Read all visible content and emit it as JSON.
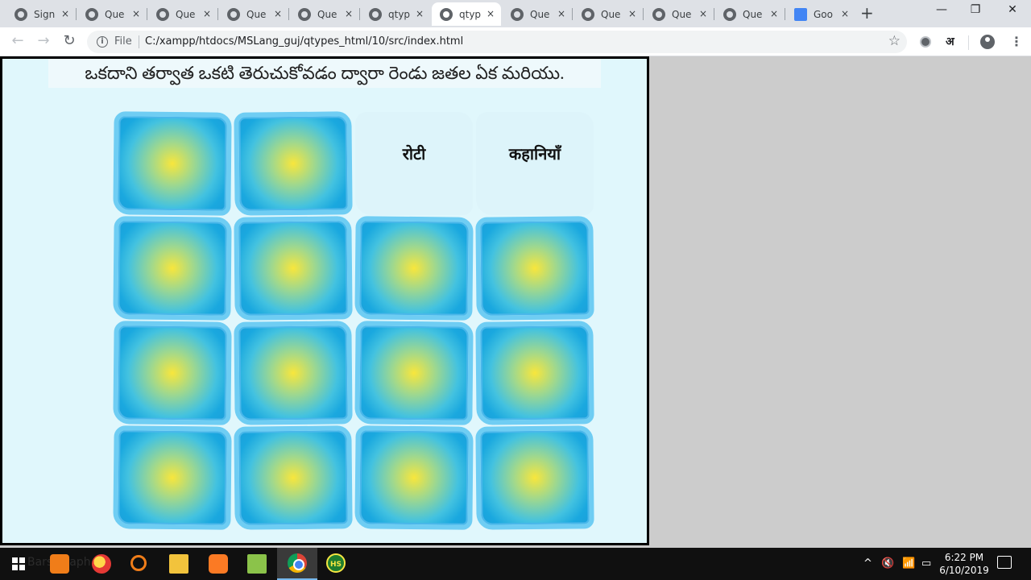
{
  "browser": {
    "tabs": [
      {
        "title": "Sign",
        "icon": "globe-icon",
        "active": false
      },
      {
        "title": "Que",
        "icon": "globe-icon",
        "active": false
      },
      {
        "title": "Que",
        "icon": "globe-icon",
        "active": false
      },
      {
        "title": "Que",
        "icon": "globe-icon",
        "active": false
      },
      {
        "title": "Que",
        "icon": "globe-icon",
        "active": false
      },
      {
        "title": "qtyp",
        "icon": "globe-icon",
        "active": false
      },
      {
        "title": "qtyp",
        "icon": "globe-icon",
        "active": true
      },
      {
        "title": "Que",
        "icon": "globe-icon",
        "active": false
      },
      {
        "title": "Que",
        "icon": "globe-icon",
        "active": false
      },
      {
        "title": "Que",
        "icon": "globe-icon",
        "active": false
      },
      {
        "title": "Que",
        "icon": "globe-icon",
        "active": false
      },
      {
        "title": "Goo",
        "icon": "google-translate-icon",
        "active": false
      }
    ],
    "tab_close_glyph": "×",
    "new_tab_glyph": "+",
    "window_controls": {
      "minimize": "—",
      "restore": "❐",
      "close": "✕"
    },
    "address": {
      "scheme_label": "File",
      "url": "C:/xampp/htdocs/MSLang_guj/qtypes_html/10/src/index.html"
    },
    "extension_label": "अ"
  },
  "game": {
    "instruction": "ఒకదాని తర్వాత ఒకటి తెరుచుకోవడం ద్వారా రెండు జతల ఏక మరియు.",
    "cards": [
      {
        "state": "closed"
      },
      {
        "state": "closed"
      },
      {
        "state": "open",
        "word": "रोटी"
      },
      {
        "state": "open",
        "word": "कहानियाँ"
      },
      {
        "state": "closed"
      },
      {
        "state": "closed"
      },
      {
        "state": "closed"
      },
      {
        "state": "closed"
      },
      {
        "state": "closed"
      },
      {
        "state": "closed"
      },
      {
        "state": "closed"
      },
      {
        "state": "closed"
      },
      {
        "state": "closed"
      },
      {
        "state": "closed"
      },
      {
        "state": "closed"
      },
      {
        "state": "closed"
      }
    ],
    "colors": {
      "background": "#e0f7fc",
      "card_center": "#f8e63c",
      "card_edge": "#1aa8df",
      "card_border": "#6fcdf3"
    }
  },
  "taskbar": {
    "clock_time": "6:22 PM",
    "clock_date": "6/10/2019",
    "search_hint": "Bars Graph",
    "hs_label": "HS",
    "tray": {
      "chevron": "^",
      "volume": "🔇",
      "wifi": "📶",
      "battery": "▭"
    }
  }
}
